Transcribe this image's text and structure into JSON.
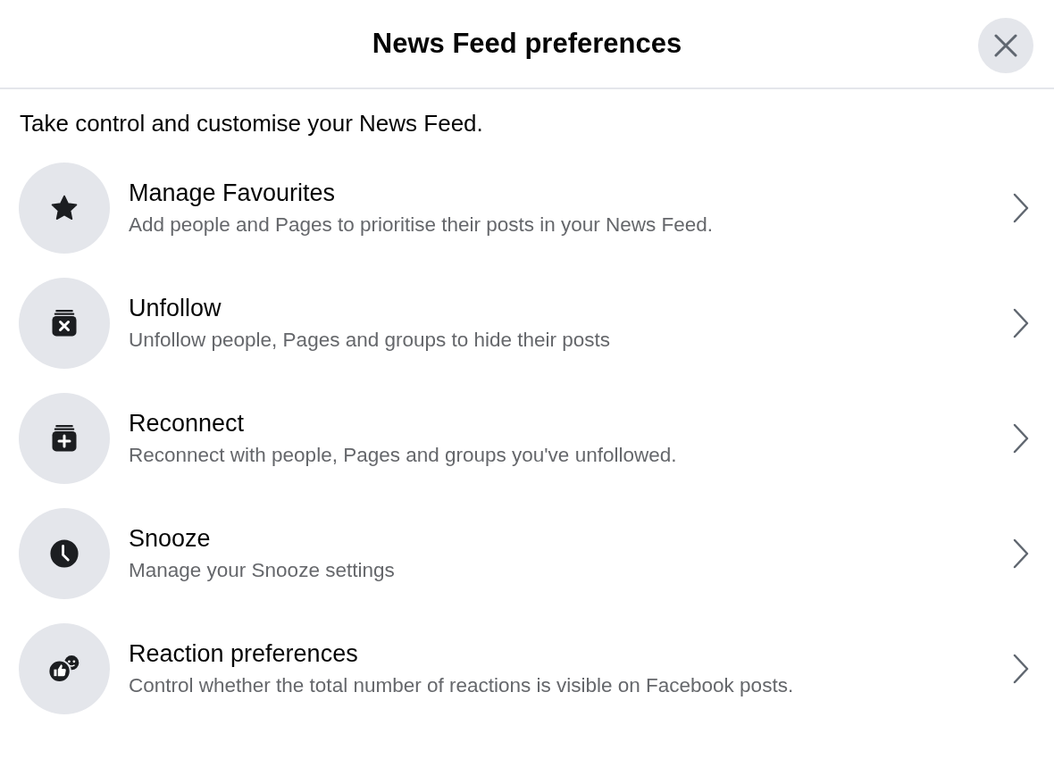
{
  "header": {
    "title": "News Feed preferences"
  },
  "intro": "Take control and customise your News Feed.",
  "items": [
    {
      "kind": "star",
      "title": "Manage Favourites",
      "description": "Add people and Pages to prioritise their posts in your News Feed."
    },
    {
      "kind": "unfollow",
      "title": "Unfollow",
      "description": "Unfollow people, Pages and groups to hide their posts"
    },
    {
      "kind": "reconnect",
      "title": "Reconnect",
      "description": "Reconnect with people, Pages and groups you've unfollowed."
    },
    {
      "kind": "clock",
      "title": "Snooze",
      "description": "Manage your Snooze settings"
    },
    {
      "kind": "reaction",
      "title": "Reaction preferences",
      "description": "Control whether the total number of reactions is visible on Facebook posts."
    }
  ]
}
